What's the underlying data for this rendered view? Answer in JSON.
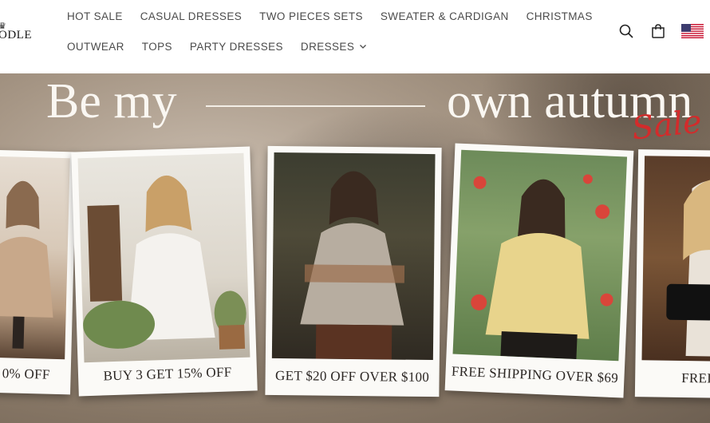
{
  "brand": {
    "logo_text": "ODLE",
    "logo_crown": "♛"
  },
  "nav": {
    "row1": [
      "HOT SALE",
      "CASUAL DRESSES",
      "TWO PIECES SETS",
      "SWEATER & CARDIGAN",
      "CHRISTMAS"
    ],
    "row2": [
      "OUTWEAR",
      "TOPS",
      "PARTY DRESSES",
      "DRESSES"
    ]
  },
  "header_icons": [
    "search-icon",
    "cart-icon",
    "us-flag-icon"
  ],
  "hero": {
    "headline_left": "Be my",
    "headline_right": "own autumn",
    "script": "Sale"
  },
  "cards": [
    {
      "caption": "0% OFF"
    },
    {
      "caption": "BUY 3 GET 15% OFF"
    },
    {
      "caption": "GET $20 OFF OVER $100"
    },
    {
      "caption": "FREE SHIPPING OVER $69"
    },
    {
      "caption": "FREI"
    }
  ],
  "colors": {
    "accent_red": "#d32b2b",
    "nav_text": "#4b4b4b"
  }
}
